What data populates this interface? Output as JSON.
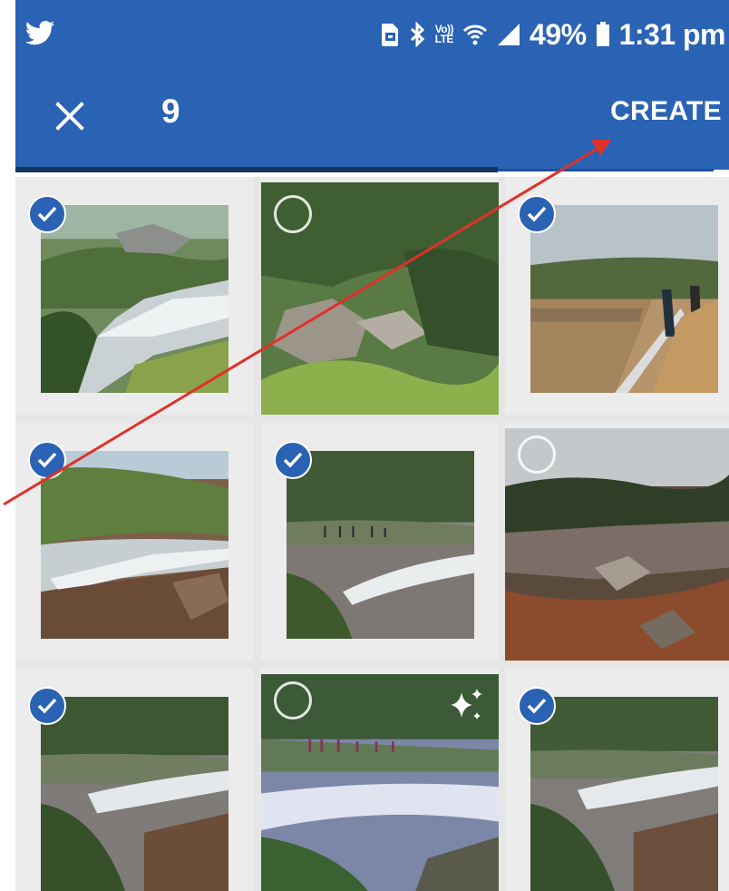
{
  "status_bar": {
    "app_icon": "twitter-bird-icon",
    "battery_percent": "49%",
    "time": "1:31 pm",
    "network": "VoLTE",
    "icons": [
      "sd-card-icon",
      "bluetooth-icon",
      "volte-icon",
      "wifi-icon",
      "signal-icon",
      "battery-icon"
    ]
  },
  "toolbar": {
    "close_icon": "close-icon",
    "selected_count": "9",
    "create_label": "CREATE"
  },
  "colors": {
    "app_bar": "#2a62b4",
    "badge_selected": "#2a62b4",
    "annotation_arrow": "#e0302a"
  },
  "photos": [
    {
      "selected": true,
      "subject": "waterfall over rocks"
    },
    {
      "selected": false,
      "subject": "river valley rocks and trees"
    },
    {
      "selected": true,
      "subject": "viewing platform with people"
    },
    {
      "selected": true,
      "subject": "waterfall cascade"
    },
    {
      "selected": true,
      "subject": "granite rocks with people"
    },
    {
      "selected": false,
      "subject": "rocky hillside"
    },
    {
      "selected": true,
      "subject": "river with rocks"
    },
    {
      "selected": false,
      "subject": "river rapids with people",
      "sparkle_icon": "sparkle-icon"
    },
    {
      "selected": true,
      "subject": "river with rocks and bushes"
    }
  ]
}
